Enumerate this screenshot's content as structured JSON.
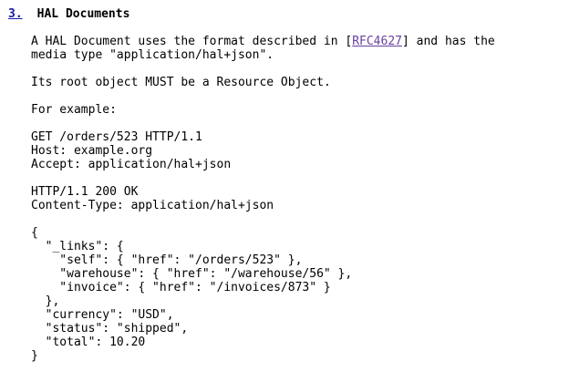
{
  "section": {
    "number": "3.",
    "title": "HAL Documents"
  },
  "intro": {
    "line1_before": "A HAL Document uses the format described in [",
    "ref_label": "RFC4627",
    "line1_after": "] and has the",
    "line2": "media type \"application/hal+json\"."
  },
  "root_statement": "Its root object MUST be a Resource Object.",
  "example_intro": "For example:",
  "request": [
    "GET /orders/523 HTTP/1.1",
    "Host: example.org",
    "Accept: application/hal+json"
  ],
  "response": [
    "HTTP/1.1 200 OK",
    "Content-Type: application/hal+json"
  ],
  "json_body": [
    "{",
    "  \"_links\": {",
    "    \"self\": { \"href\": \"/orders/523\" },",
    "    \"warehouse\": { \"href\": \"/warehouse/56\" },",
    "    \"invoice\": { \"href\": \"/invoices/873\" }",
    "  },",
    "  \"currency\": \"USD\",",
    "  \"status\": \"shipped\",",
    "  \"total\": 10.20",
    "}"
  ],
  "colors": {
    "section_link": "#1a1aa6",
    "ref_link": "#6a3fa0"
  }
}
